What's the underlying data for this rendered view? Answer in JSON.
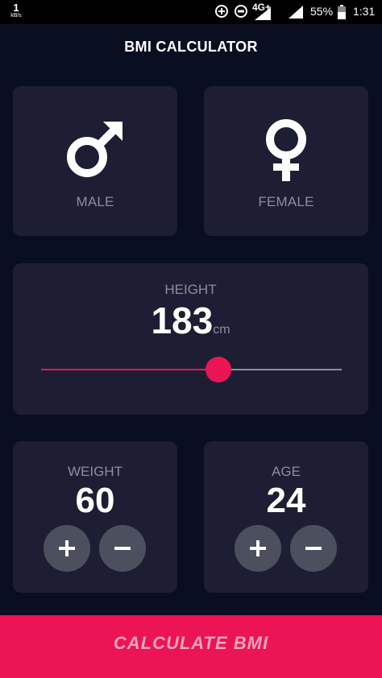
{
  "status_bar": {
    "speed_value": "1",
    "speed_unit": "kB/s",
    "network": "4G+",
    "battery": "55%",
    "time": "1:31"
  },
  "app": {
    "title": "BMI CALCULATOR"
  },
  "gender": {
    "male_label": "MALE",
    "female_label": "FEMALE",
    "male_icon": "male-symbol-icon",
    "female_icon": "female-symbol-icon"
  },
  "height": {
    "label": "HEIGHT",
    "value": "183",
    "unit": "cm",
    "slider_fraction": 0.59
  },
  "weight": {
    "label": "WEIGHT",
    "value": "60",
    "plus_icon": "plus-icon",
    "minus_icon": "minus-icon"
  },
  "age": {
    "label": "AGE",
    "value": "24",
    "plus_icon": "plus-icon",
    "minus_icon": "minus-icon"
  },
  "calculate_button": {
    "label": "CALCULATE BMI"
  },
  "colors": {
    "background": "#0a0e21",
    "card": "#1d1e33",
    "accent": "#eb1555",
    "muted_text": "#8d8e98",
    "round_button": "#4c4f5e"
  }
}
